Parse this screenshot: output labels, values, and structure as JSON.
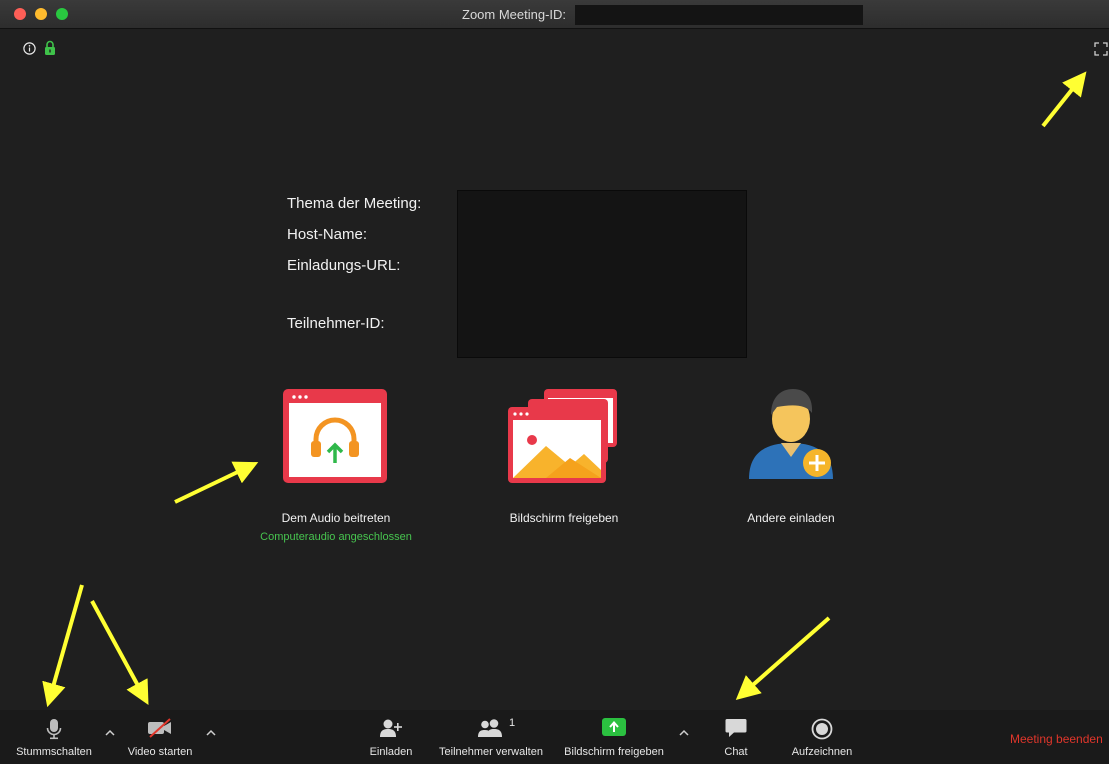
{
  "window": {
    "title": "Zoom Meeting-ID:"
  },
  "meeting_info": {
    "topic_label": "Thema der Meeting:",
    "host_label": "Host-Name:",
    "url_label": "Einladungs-URL:",
    "participant_id_label": "Teilnehmer-ID:"
  },
  "actions": {
    "audio_label": "Dem Audio beitreten",
    "audio_status": "Computeraudio angeschlossen",
    "share_label": "Bildschirm freigeben",
    "invite_label": "Andere einladen"
  },
  "toolbar": {
    "mute_label": "Stummschalten",
    "video_label": "Video starten",
    "invite_label": "Einladen",
    "participants_label": "Teilnehmer verwalten",
    "participants_count": "1",
    "share_label": "Bildschirm freigeben",
    "chat_label": "Chat",
    "record_label": "Aufzeichnen",
    "end_label": "Meeting beenden"
  },
  "colors": {
    "end_meeting": "#e0362b",
    "audio_status": "#47c44f",
    "share_accent": "#2bc040",
    "annotation_arrow": "#ffff33"
  },
  "icons": {
    "info": "info-icon",
    "lock": "lock-icon",
    "fullscreen": "fullscreen-icon",
    "mic": "microphone-icon",
    "video_off": "video-off-icon",
    "invite": "add-user-icon",
    "participants": "participants-icon",
    "share": "share-screen-icon",
    "chat": "chat-bubble-icon",
    "record": "record-icon"
  }
}
